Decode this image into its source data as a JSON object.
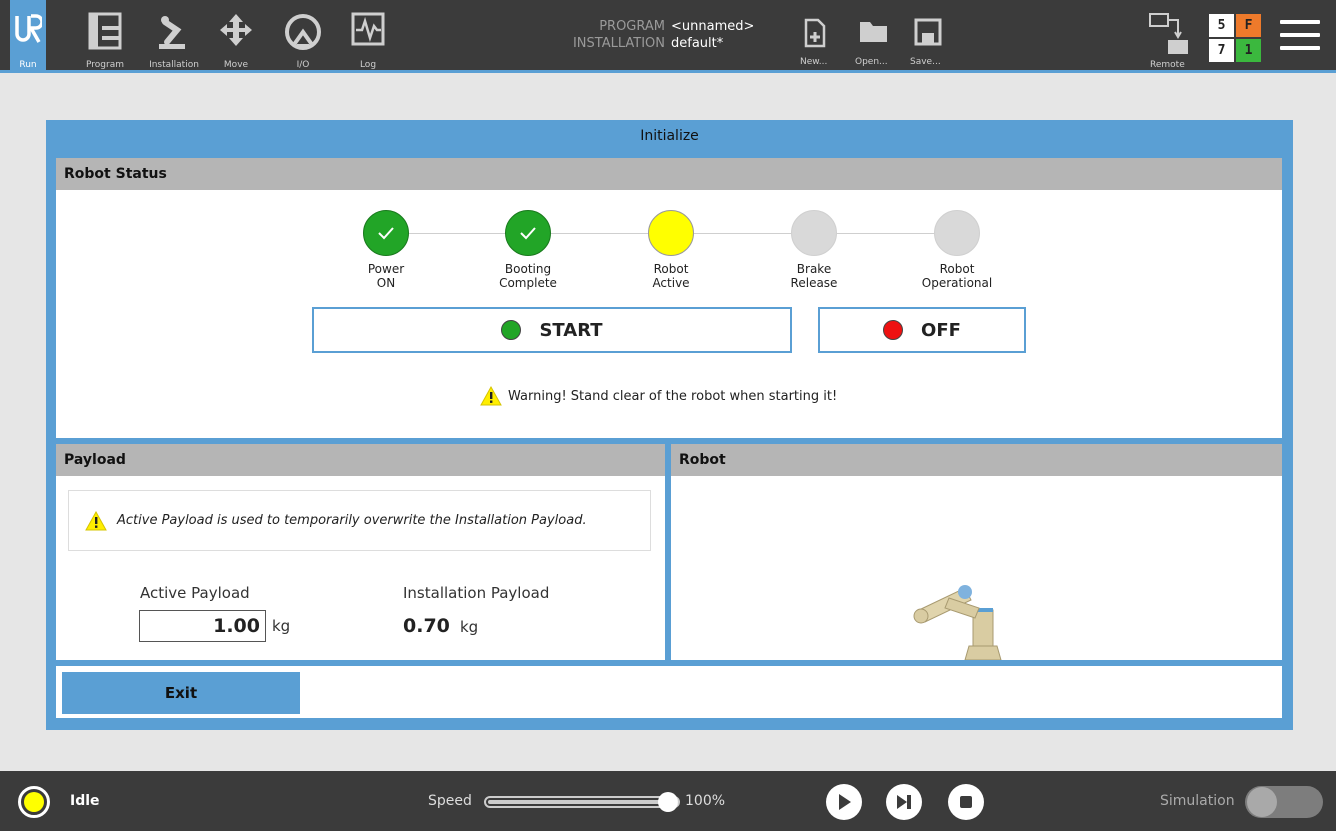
{
  "nav": {
    "run": "Run",
    "program": "Program",
    "installation": "Installation",
    "move": "Move",
    "io": "I/O",
    "log": "Log"
  },
  "program_info": {
    "program_key": "PROGRAM",
    "program_val": "<unnamed>",
    "installation_key": "INSTALLATION",
    "installation_val": "default*"
  },
  "file": {
    "new": "New...",
    "open": "Open...",
    "save": "Save..."
  },
  "remote": "Remote",
  "counters": {
    "a": "5",
    "b": "F",
    "c": "7",
    "d": "1"
  },
  "dialog": {
    "title": "Initialize",
    "robot_status": {
      "heading": "Robot Status",
      "steps": [
        {
          "label": "Power\nON",
          "state": "done"
        },
        {
          "label": "Booting\nComplete",
          "state": "done"
        },
        {
          "label": "Robot\nActive",
          "state": "active"
        },
        {
          "label": "Brake\nRelease",
          "state": "pending"
        },
        {
          "label": "Robot\nOperational",
          "state": "pending"
        }
      ],
      "start_label": "START",
      "off_label": "OFF",
      "warning": "Warning! Stand clear of the robot when starting it!"
    },
    "payload": {
      "heading": "Payload",
      "note": "Active Payload is used to temporarily overwrite the Installation Payload.",
      "active_label": "Active Payload",
      "active_value": "1.00",
      "installation_label": "Installation Payload",
      "installation_value": "0.70",
      "unit": "kg"
    },
    "robot": {
      "heading": "Robot"
    },
    "exit_label": "Exit"
  },
  "footer": {
    "status": "Idle",
    "speed_label": "Speed",
    "speed_value": "100%",
    "speed_fraction": 1.0,
    "simulation_label": "Simulation"
  },
  "colors": {
    "accent": "#5a9fd4",
    "done": "#22a527",
    "active": "#ffff00",
    "pending": "#d9d9d9",
    "off": "#ee1111"
  }
}
